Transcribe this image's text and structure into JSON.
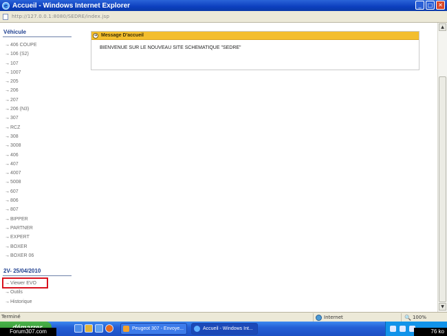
{
  "window": {
    "title": "Accueil - Windows Internet Explorer",
    "minimize_glyph": "_",
    "maximize_glyph": "□",
    "close_glyph": "✕"
  },
  "address": {
    "url": "http://127.0.0.1:8080/SEDRE/index.jsp"
  },
  "sidebar": {
    "title": "Véhicule",
    "items": [
      "406 COUPE",
      "106 (S2)",
      "107",
      "1007",
      "205",
      "206",
      "207",
      "206 (N3)",
      "307",
      "RCZ",
      "308",
      "3008",
      "406",
      "407",
      "4007",
      "5008",
      "607",
      "806",
      "807",
      "BIPPER",
      "PARTNER",
      "EXPERT",
      "BOXER",
      "BOXER 06"
    ],
    "section2_title": "2V- 25/04/2010",
    "items2": [
      "Viewer EVO",
      "Outils",
      "Historique"
    ],
    "arrow": "→"
  },
  "panel": {
    "title": "Message D'accueil",
    "message": "BIENVENUE SUR LE NOUVEAU SITE SCHEMATIQUE \"SEDRE\"",
    "icon": "arrow-right-circle-icon"
  },
  "statusbar": {
    "left": "Terminé",
    "zone": "Internet",
    "zoom": "100%"
  },
  "taskbar": {
    "start": "démarrer",
    "watermark": "Forum307.com",
    "tasks": [
      "Peugeot 307 - Envoye...",
      "Accueil - Windows Int..."
    ],
    "tray_text": "76 ko"
  },
  "colors": {
    "accent_header": "#f3be2e",
    "highlight_box": "#d8101c",
    "title_bar": "#0c3fbf"
  }
}
